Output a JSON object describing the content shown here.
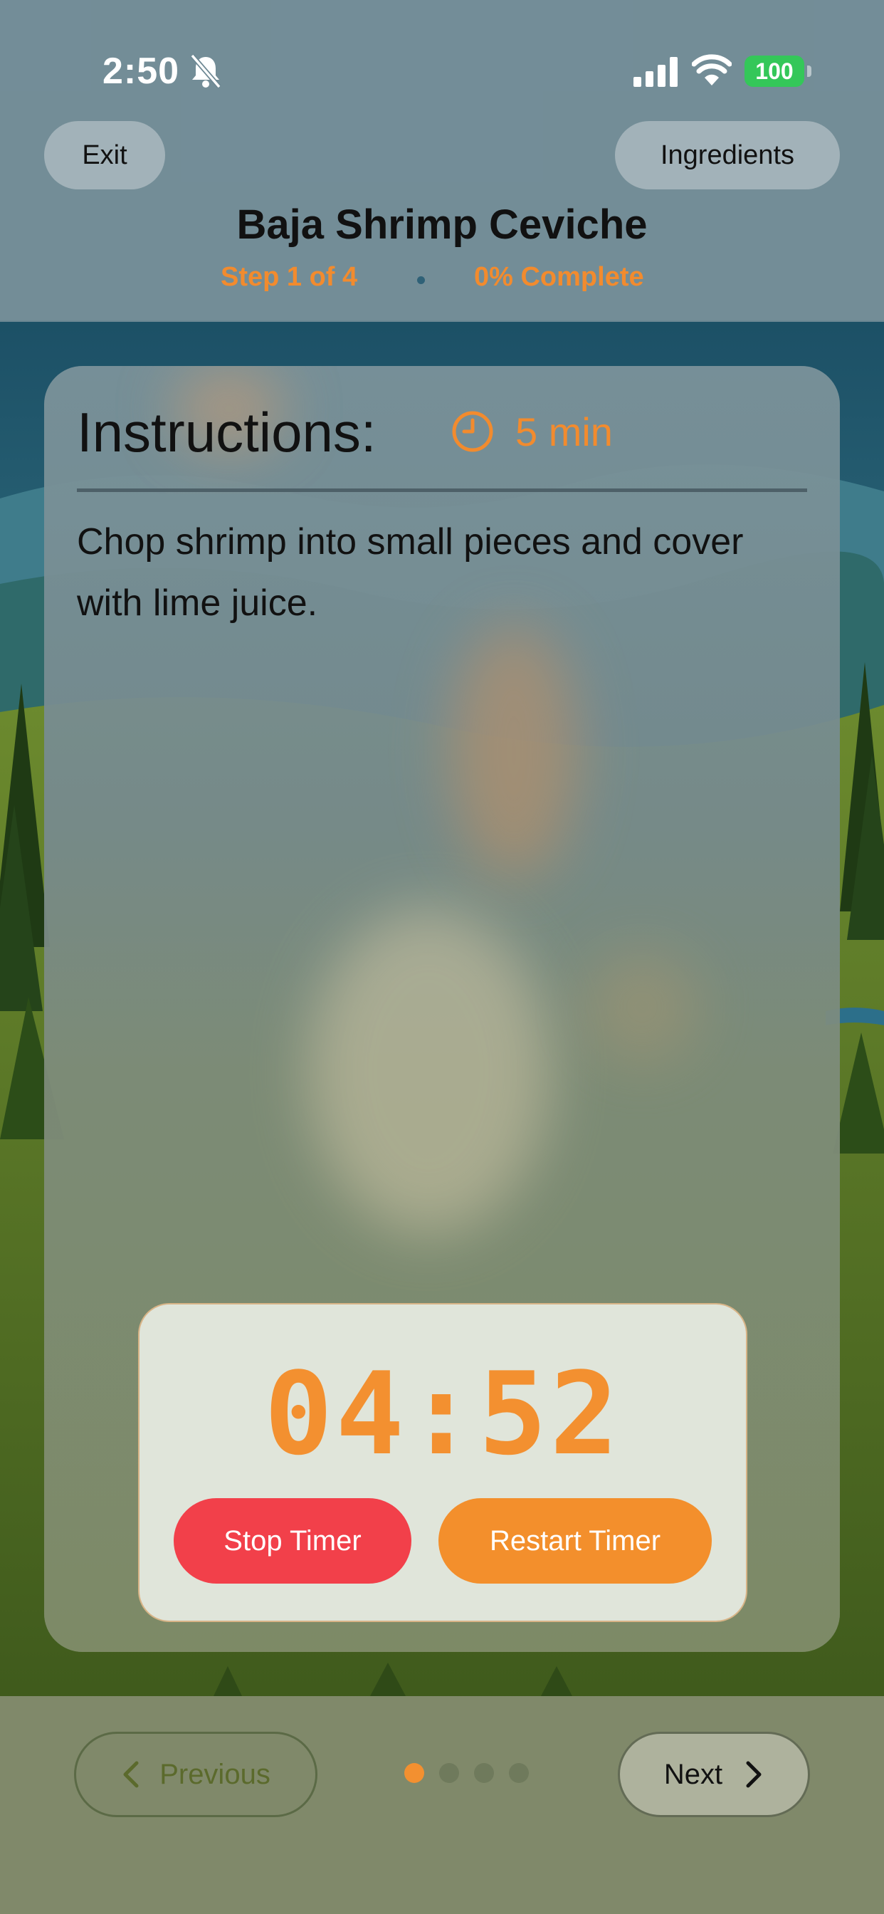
{
  "status_bar": {
    "time": "2:50",
    "battery": "100",
    "icons": [
      "bell-slash-icon",
      "signal-icon",
      "wifi-icon",
      "battery-icon"
    ]
  },
  "header": {
    "exit_label": "Exit",
    "ingredients_label": "Ingredients",
    "recipe_title": "Baja Shrimp Ceviche",
    "step_label": "Step 1 of 4",
    "complete_label": "0% Complete"
  },
  "card": {
    "heading": "Instructions:",
    "duration": "5 min",
    "instruction": "Chop shrimp into small pieces and cover with lime juice."
  },
  "timer": {
    "value": "04:52",
    "stop_label": "Stop Timer",
    "restart_label": "Restart Timer"
  },
  "navigation": {
    "previous_label": "Previous",
    "next_label": "Next",
    "total_steps": 4,
    "current_step": 1
  },
  "colors": {
    "accent": "#f39030",
    "stop": "#f2404a",
    "battery": "#34c759"
  }
}
